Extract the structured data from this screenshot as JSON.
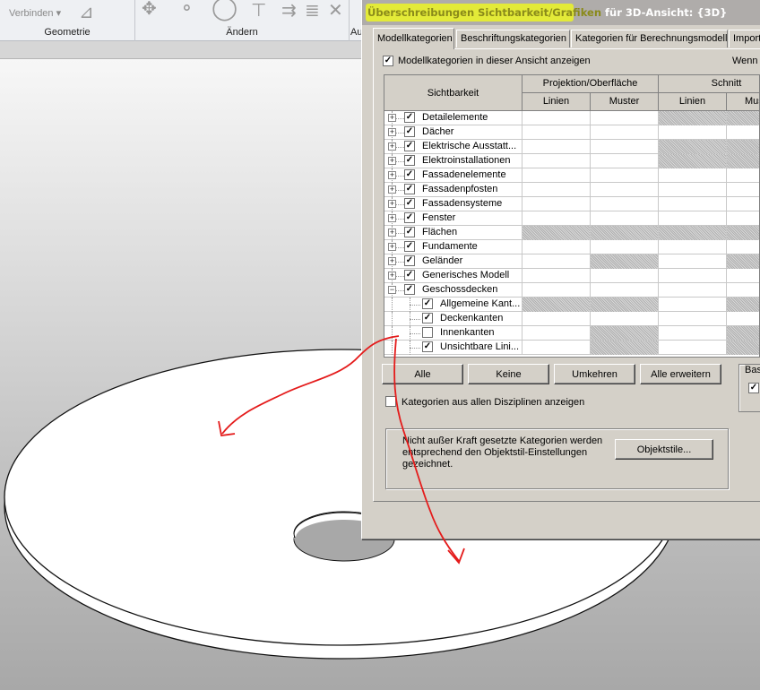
{
  "ribbon": {
    "connect_label": "Verbinden",
    "panel_geometry": "Geometrie",
    "panel_modify": "Ändern",
    "panel_cut": "Au"
  },
  "dialog": {
    "title_highlight": "Überschreibungen Sichtbarkeit/Grafiken",
    "title_rest": " für 3D-Ansicht: {3D}",
    "highlight_color": "#e3ea38",
    "tabs": [
      "Modellkategorien",
      "Beschriftungskategorien",
      "Kategorien für Berechnungsmodell",
      "Import"
    ],
    "show_model_categories_label": "Modellkategorien in dieser Ansicht anzeigen",
    "show_model_categories_checked": true,
    "filter_label": "Wenn",
    "table": {
      "col_visibility": "Sichtbarkeit",
      "group_projection": "Projektion/Oberfläche",
      "group_section": "Schnitt",
      "sub_lines": "Linien",
      "sub_pattern": "Muster",
      "sub_lines_2": "Linien",
      "sub_pattern_2": "Mus"
    },
    "rows": [
      {
        "label": "Detailelemente",
        "checked": true,
        "expander": "+",
        "level": 0,
        "hatch": [
          false,
          false,
          true,
          true
        ]
      },
      {
        "label": "Dächer",
        "checked": true,
        "expander": "+",
        "level": 0,
        "hatch": [
          false,
          false,
          false,
          false
        ]
      },
      {
        "label": "Elektrische Ausstatt...",
        "checked": true,
        "expander": "+",
        "level": 0,
        "hatch": [
          false,
          false,
          true,
          true
        ]
      },
      {
        "label": "Elektroinstallationen",
        "checked": true,
        "expander": "+",
        "level": 0,
        "hatch": [
          false,
          false,
          true,
          true
        ]
      },
      {
        "label": "Fassadenelemente",
        "checked": true,
        "expander": "+",
        "level": 0,
        "hatch": [
          false,
          false,
          false,
          false
        ]
      },
      {
        "label": "Fassadenpfosten",
        "checked": true,
        "expander": "+",
        "level": 0,
        "hatch": [
          false,
          false,
          false,
          false
        ]
      },
      {
        "label": "Fassadensysteme",
        "checked": true,
        "expander": "+",
        "level": 0,
        "hatch": [
          false,
          false,
          false,
          false
        ]
      },
      {
        "label": "Fenster",
        "checked": true,
        "expander": "+",
        "level": 0,
        "hatch": [
          false,
          false,
          false,
          false
        ]
      },
      {
        "label": "Flächen",
        "checked": true,
        "expander": "+",
        "level": 0,
        "hatch": [
          true,
          true,
          true,
          true
        ]
      },
      {
        "label": "Fundamente",
        "checked": true,
        "expander": "+",
        "level": 0,
        "hatch": [
          false,
          false,
          false,
          false
        ]
      },
      {
        "label": "Geländer",
        "checked": true,
        "expander": "+",
        "level": 0,
        "hatch": [
          false,
          true,
          false,
          true
        ]
      },
      {
        "label": "Generisches Modell",
        "checked": true,
        "expander": "+",
        "level": 0,
        "hatch": [
          false,
          false,
          false,
          false
        ]
      },
      {
        "label": "Geschossdecken",
        "checked": true,
        "expander": "-",
        "level": 0,
        "hatch": [
          false,
          false,
          false,
          false
        ]
      },
      {
        "label": "Allgemeine Kant...",
        "checked": true,
        "expander": "",
        "level": 1,
        "hatch": [
          true,
          true,
          false,
          true
        ]
      },
      {
        "label": "Deckenkanten",
        "checked": true,
        "expander": "",
        "level": 1,
        "hatch": [
          false,
          false,
          false,
          false
        ]
      },
      {
        "label": "Innenkanten",
        "checked": false,
        "expander": "",
        "level": 1,
        "hatch": [
          false,
          true,
          false,
          true
        ]
      },
      {
        "label": "Unsichtbare Lini...",
        "checked": true,
        "expander": "",
        "level": 1,
        "hatch": [
          false,
          true,
          false,
          true
        ]
      }
    ],
    "buttons": {
      "all": "Alle",
      "none": "Keine",
      "invert": "Umkehren",
      "expand_all": "Alle erweitern",
      "object_styles": "Objektstile..."
    },
    "show_all_disciplines_label": "Kategorien aus allen Disziplinen anzeigen",
    "show_all_disciplines_checked": false,
    "basis_label": "Bas",
    "info_text": "Nicht außer Kraft gesetzte Kategorien werden entsprechend den Objektstil-Einstellungen gezeichnet."
  },
  "annotation": {
    "arrow_color": "#e41b1b"
  }
}
